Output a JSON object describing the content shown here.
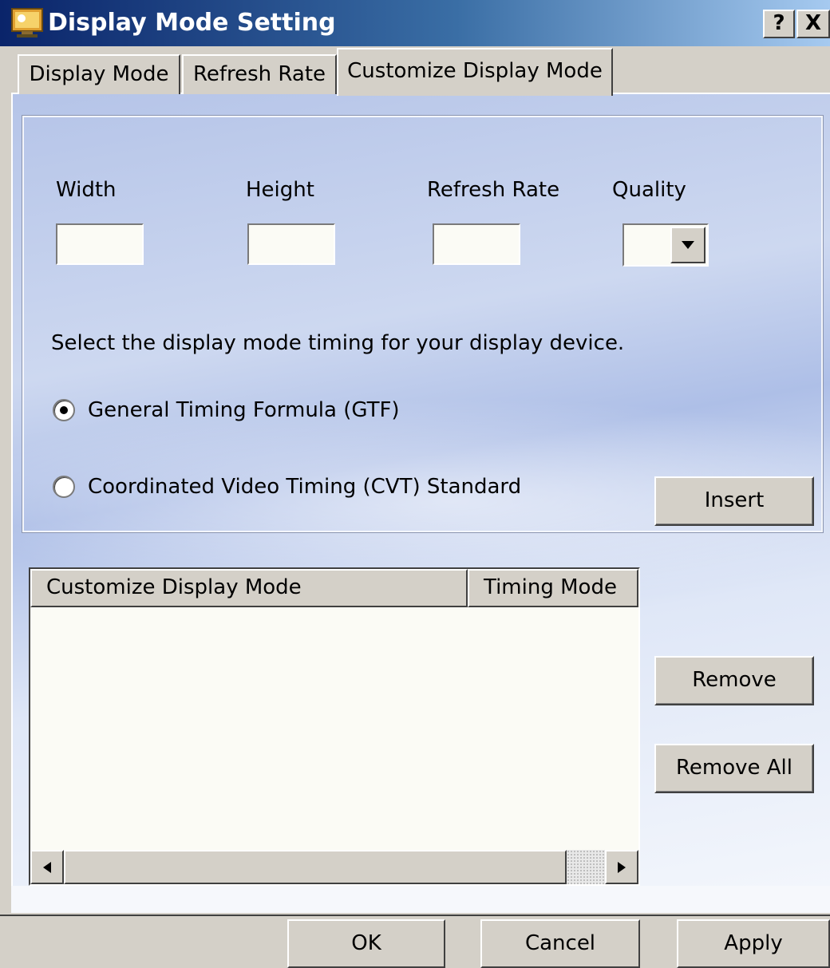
{
  "window": {
    "title": "Display Mode Setting",
    "help_label": "?",
    "close_label": "X"
  },
  "tabs": [
    {
      "label": "Display Mode",
      "selected": false
    },
    {
      "label": "Refresh Rate",
      "selected": false
    },
    {
      "label": "Customize Display Mode",
      "selected": true
    }
  ],
  "form": {
    "width_label": "Width",
    "height_label": "Height",
    "refresh_rate_label": "Refresh Rate",
    "quality_label": "Quality",
    "width_value": "",
    "height_value": "",
    "refresh_rate_value": "",
    "quality_value": "",
    "timing_prompt": "Select the display mode timing for your display device.",
    "radio_gtf_label": "General Timing Formula (GTF)",
    "radio_cvt_label": "Coordinated Video Timing (CVT) Standard",
    "selected_timing": "GTF",
    "insert_label": "Insert"
  },
  "list": {
    "columns": [
      "Customize Display Mode",
      "Timing Mode"
    ],
    "rows": []
  },
  "side_buttons": {
    "remove_label": "Remove",
    "remove_all_label": "Remove All"
  },
  "footer": {
    "ok_label": "OK",
    "cancel_label": "Cancel",
    "apply_label": "Apply"
  },
  "colors": {
    "titlebar": "#0a246a",
    "panel_blue": "#b5c4e8",
    "dialog_face": "#d4d0c8"
  }
}
